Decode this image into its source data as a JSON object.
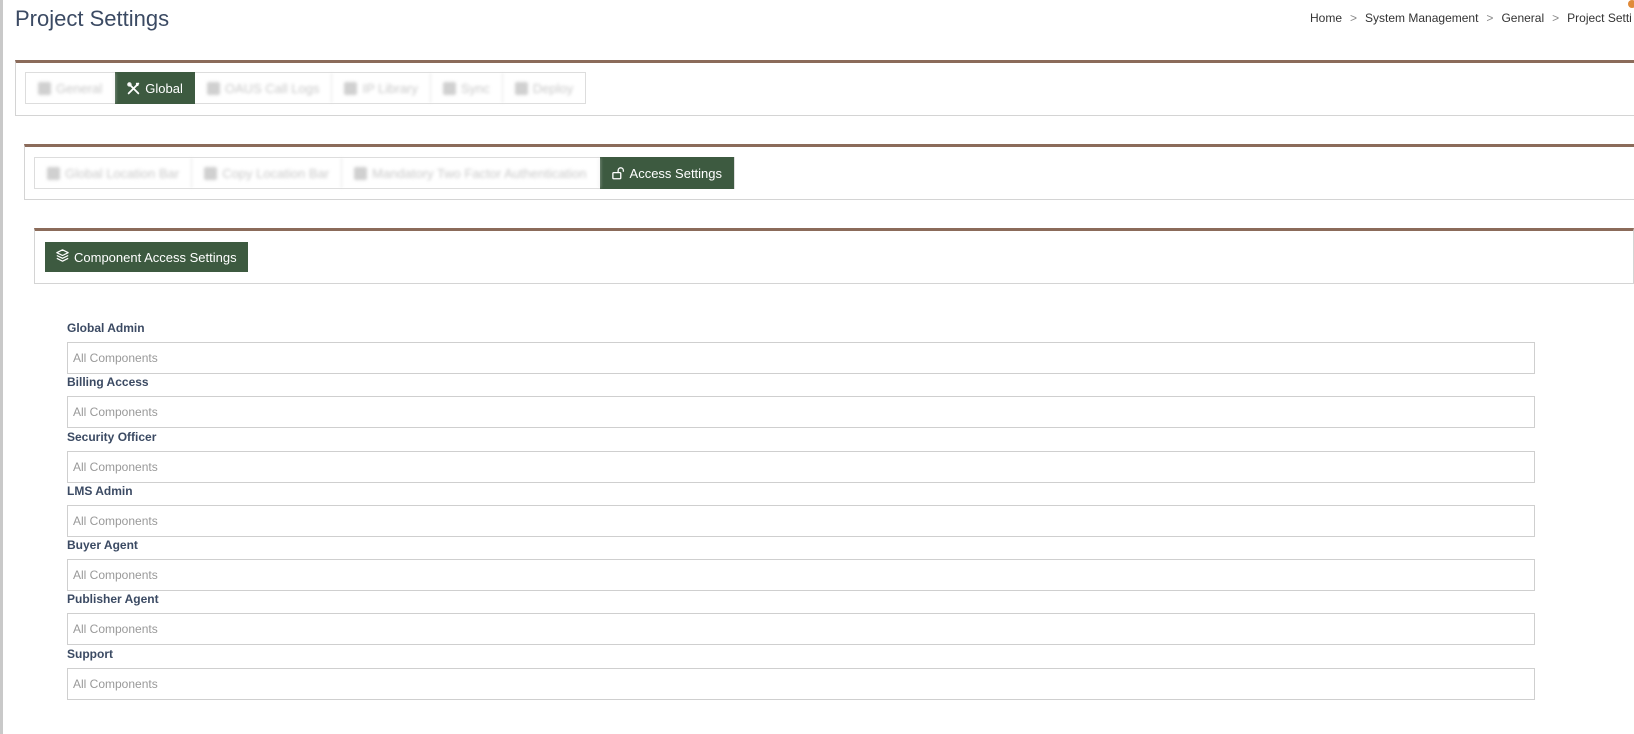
{
  "page": {
    "title": "Project Settings"
  },
  "breadcrumb": [
    "Home",
    "System Management",
    "General",
    "Project Setti"
  ],
  "tabs_level1": [
    {
      "label": "General",
      "icon": "gear-icon",
      "blurred": true
    },
    {
      "label": "Global",
      "icon": "tools-icon",
      "active": true
    },
    {
      "label": "OAUS Call Logs",
      "icon": "link-icon",
      "blurred": true
    },
    {
      "label": "IP Library",
      "icon": "grid-icon",
      "blurred": true
    },
    {
      "label": "Sync",
      "icon": "link-icon",
      "blurred": true
    },
    {
      "label": "Deploy",
      "icon": "gear-icon",
      "blurred": true
    }
  ],
  "tabs_level2": [
    {
      "label": "Global Location Bar",
      "icon": "grid-icon",
      "blurred": true
    },
    {
      "label": "Copy Location Bar",
      "icon": "grid-icon",
      "blurred": true
    },
    {
      "label": "Mandatory Two Factor Authentication",
      "icon": "link-icon",
      "blurred": true
    },
    {
      "label": "Access Settings",
      "icon": "unlock-icon",
      "active": true
    }
  ],
  "component_button": {
    "label": "Component Access Settings",
    "icon": "layers-icon"
  },
  "fields": [
    {
      "label": "Global Admin",
      "value": "All Components"
    },
    {
      "label": "Billing Access",
      "value": "All Components"
    },
    {
      "label": "Security Officer",
      "value": "All Components"
    },
    {
      "label": "LMS Admin",
      "value": "All Components"
    },
    {
      "label": "Buyer Agent",
      "value": "All Components"
    },
    {
      "label": "Publisher Agent",
      "value": "All Components"
    },
    {
      "label": "Support",
      "value": "All Components"
    }
  ],
  "colors": {
    "accent": "#3d5a40",
    "panel_border": "#8b6b5a",
    "title": "#3b4a63"
  }
}
